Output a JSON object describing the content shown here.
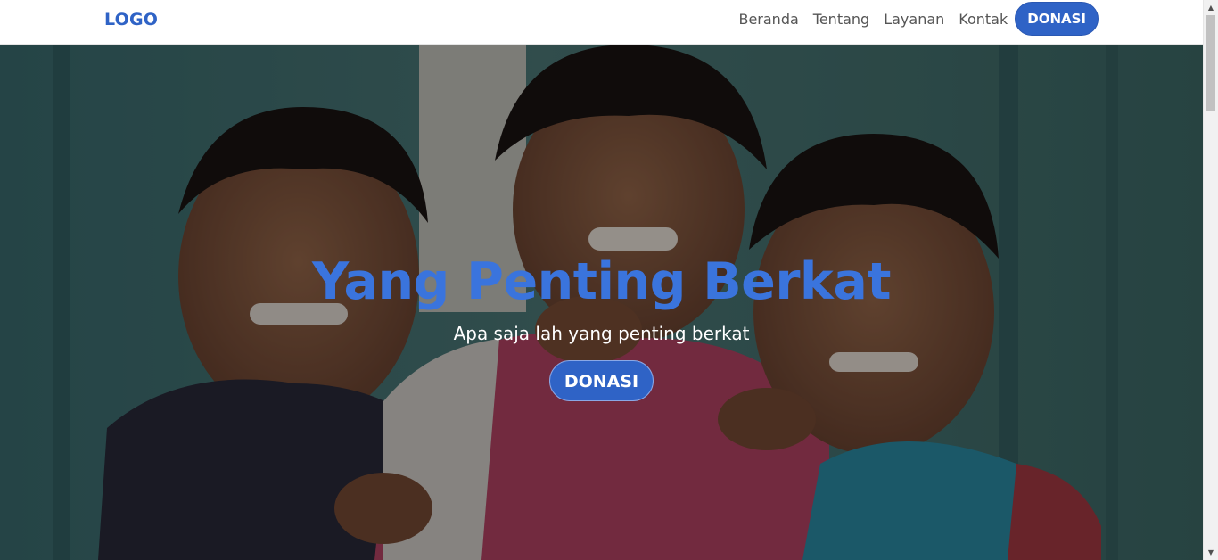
{
  "navbar": {
    "logo": "LOGO",
    "links": [
      "Beranda",
      "Tentang",
      "Layanan",
      "Kontak"
    ],
    "donate_label": "DONASI"
  },
  "hero": {
    "title": "Yang Penting Berkat",
    "subtitle": "Apa saja lah yang penting berkat",
    "button_label": "DONASI"
  },
  "colors": {
    "brand": "#2f63c6",
    "title": "#3a74dd"
  }
}
